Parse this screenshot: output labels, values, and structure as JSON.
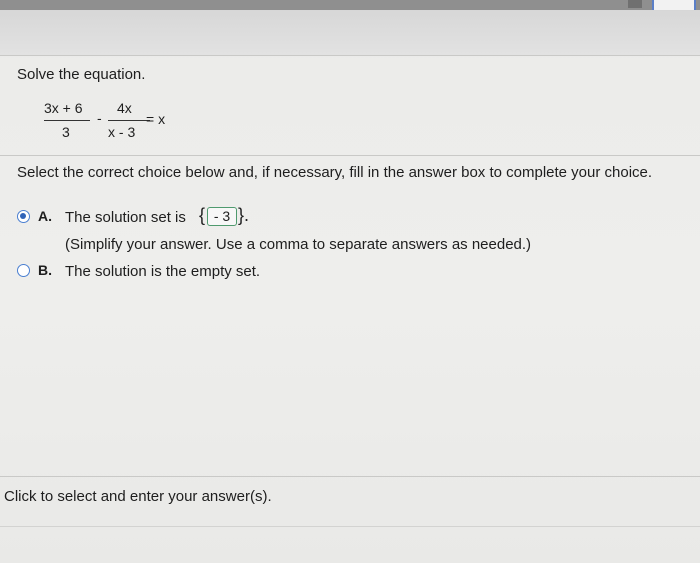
{
  "question": {
    "prompt": "Solve the equation.",
    "equation": {
      "term1_numerator": "3x + 6",
      "term1_denominator": "3",
      "operator": "-",
      "term2_numerator": "4x",
      "term2_denominator": "x - 3",
      "rhs": "= x"
    }
  },
  "instruction": "Select the correct choice below and, if necessary, fill in the answer box to complete your choice.",
  "choices": [
    {
      "letter": "A.",
      "text": "The solution set is",
      "open_brace": "{",
      "answer_value": "- 3",
      "close_brace": "}.",
      "hint": "(Simplify your answer. Use a comma to separate answers as needed.)",
      "selected": true
    },
    {
      "letter": "B.",
      "text": "The solution is the empty set.",
      "selected": false
    }
  ],
  "footer": "Click to select and enter your answer(s).",
  "colors": {
    "radio_accent": "#2f63b8",
    "answer_box_border": "#4f9a6e"
  }
}
